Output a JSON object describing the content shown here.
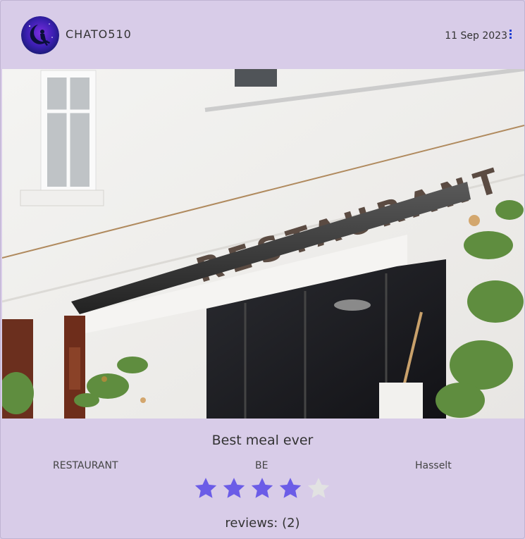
{
  "post": {
    "username": "CHATO510",
    "date": "11 Sep 2023",
    "title": "Best meal ever",
    "category": "RESTAURANT",
    "country": "BE",
    "city": "Hasselt",
    "reviews_label": "reviews: (2)"
  },
  "photo": {
    "sign_text": "RESTAURANT"
  },
  "rating": {
    "value": 4,
    "max": 5,
    "filled_color": "#6b5ce7",
    "empty_color": "#e2e2e2"
  },
  "icons": {
    "avatar": "moon-girl-icon",
    "menu": "kebab-menu-icon",
    "star": "star-icon"
  }
}
